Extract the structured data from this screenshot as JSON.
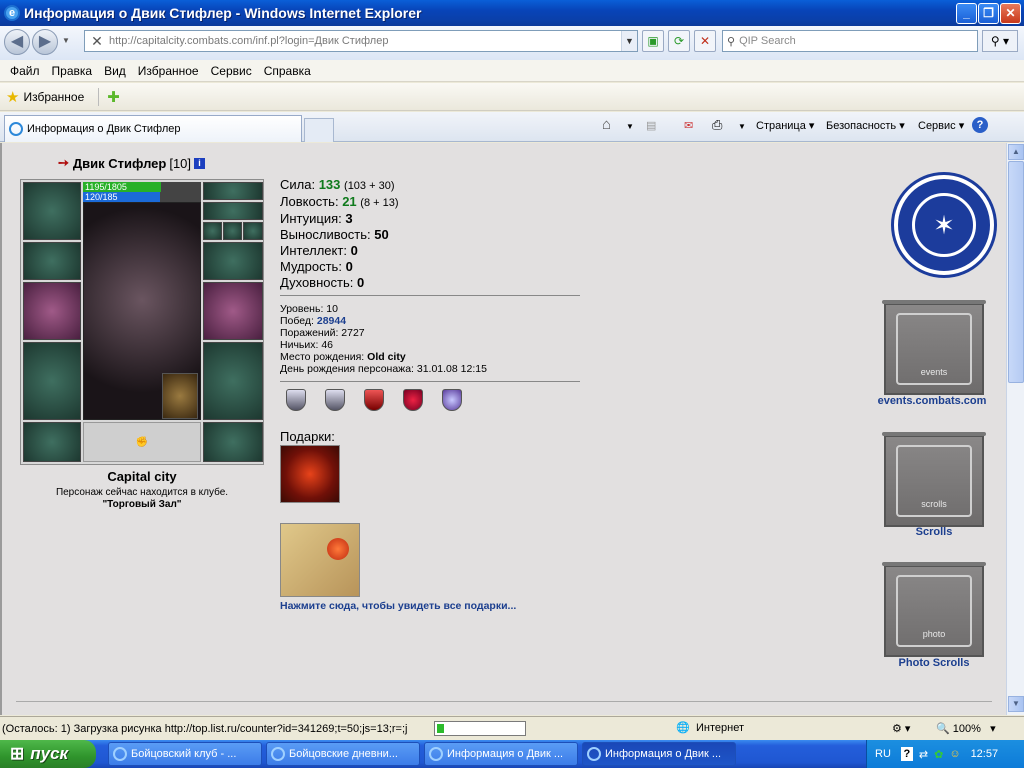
{
  "window": {
    "title": "Информация о Двик Стифлер - Windows Internet Explorer",
    "minimize": "_",
    "maximize": "❐",
    "close": "✕"
  },
  "address": {
    "url": "http://capitalcity.combats.com/inf.pl?login=Двик Стифлер",
    "search_placeholder": "QIP Search"
  },
  "menu": [
    "Файл",
    "Правка",
    "Вид",
    "Избранное",
    "Сервис",
    "Справка"
  ],
  "favorites": {
    "label": "Избранное"
  },
  "tabs": {
    "active_title": "Информация о Двик Стифлер"
  },
  "commandbar": {
    "page": "Страница",
    "security": "Безопасность",
    "service": "Сервис"
  },
  "character": {
    "name": "Двик Стифлер",
    "level": "[10]",
    "hp": "1195/1805",
    "hp_fraction": 0.662,
    "mana": "120/185",
    "mana_fraction": 0.649,
    "city": "Capital city",
    "location_text": "Персонаж сейчас находится в клубе.",
    "location_room": "\"Торговый Зал\""
  },
  "stats": [
    {
      "label": "Сила:",
      "value": "133",
      "extra": "(103 + 30)",
      "green": true
    },
    {
      "label": "Ловкость:",
      "value": "21",
      "extra": "(8 + 13)",
      "green": true
    },
    {
      "label": "Интуиция:",
      "value": "3",
      "extra": "",
      "green": false
    },
    {
      "label": "Выносливость:",
      "value": "50",
      "extra": "",
      "green": false
    },
    {
      "label": "Интеллект:",
      "value": "0",
      "extra": "",
      "green": false
    },
    {
      "label": "Мудрость:",
      "value": "0",
      "extra": "",
      "green": false
    },
    {
      "label": "Духовность:",
      "value": "0",
      "extra": "",
      "green": false
    }
  ],
  "info": {
    "level": "Уровень: 10",
    "wins_label": "Побед:",
    "wins": "28944",
    "losses": "Поражений: 2727",
    "draws": "Ничьих: 46",
    "birthplace_label": "Место рождения:",
    "birthplace": "Old city",
    "birthday": "День рождения персонажа: 31.01.08 12:15"
  },
  "gifts": {
    "label": "Подарки:",
    "link": "Нажмите сюда, чтобы увидеть все подарки..."
  },
  "right_links": {
    "events_caption": "events",
    "events_label": "events.combats.com",
    "scrolls_caption": "scrolls",
    "scrolls_label": "Scrolls",
    "photo_caption": "photo",
    "photo_label": "Photo Scrolls"
  },
  "statusbar": {
    "text": "(Осталось: 1) Загрузка рисунка http://top.list.ru/counter?id=341269;t=50;js=13;r=;j",
    "progress_fraction": 0.08,
    "zone": "Интернет",
    "zoom": "100%"
  },
  "taskbar": {
    "start": "пуск",
    "items": [
      "Бойцовский клуб - ...",
      "Бойцовские дневни...",
      "Информация о Двик ...",
      "Информация о Двик ..."
    ],
    "lang": "RU",
    "time": "12:57"
  },
  "colors": {
    "titlebar": "#0a5fd8",
    "stat_green": "#0f7a1c",
    "link_blue": "#1c3f8f",
    "hp_green": "#27b027",
    "mana_blue": "#1b6ad8"
  }
}
